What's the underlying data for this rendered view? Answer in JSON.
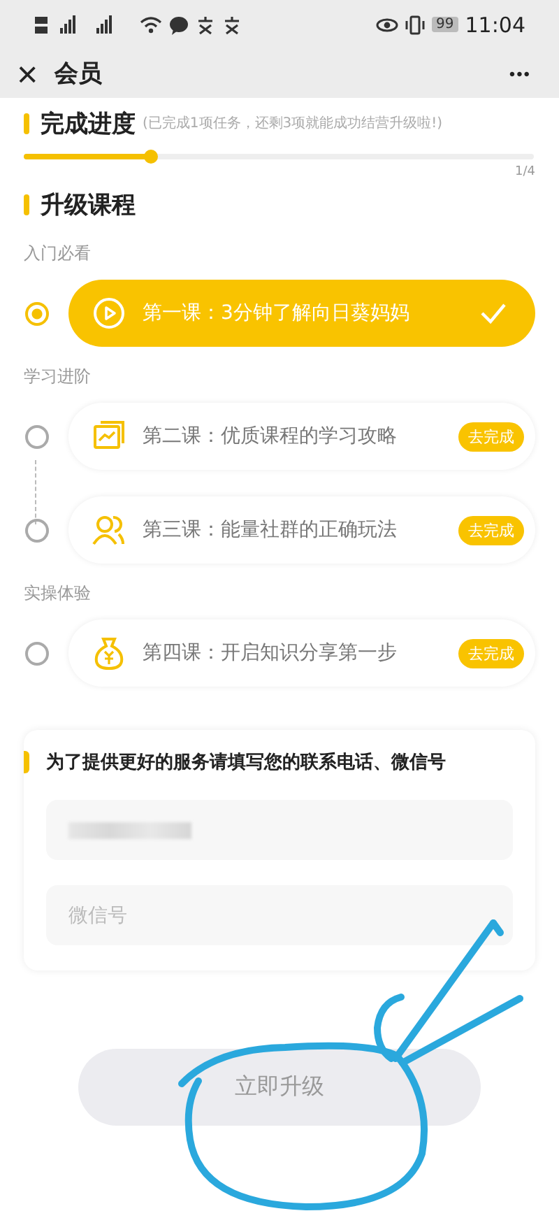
{
  "status_bar": {
    "battery": "99",
    "time": "11:04"
  },
  "nav": {
    "close": "×",
    "title": "会员",
    "more": "•••"
  },
  "progress": {
    "title": "完成进度",
    "note": "(已完成1项任务，还剩3项就能成功结营升级啦!)",
    "level": 0.25,
    "count": "1/4"
  },
  "courses": {
    "title": "升级课程",
    "groups": [
      {
        "label": "入门必看",
        "lessons": [
          {
            "title": "第一课：3分钟了解向日葵妈妈",
            "done": true
          }
        ]
      },
      {
        "label": "学习进阶",
        "lessons": [
          {
            "title": "第二课：优质课程的学习攻略",
            "done": false,
            "action": "去完成"
          },
          {
            "title": "第三课：能量社群的正确玩法",
            "done": false,
            "action": "去完成"
          }
        ]
      },
      {
        "label": "实操体验",
        "lessons": [
          {
            "title": "第四课：开启知识分享第一步",
            "done": false,
            "action": "去完成"
          }
        ]
      }
    ]
  },
  "contact": {
    "title": "为了提供更好的服务请填写您的联系电话、微信号",
    "fields": [
      {
        "kind": "redacted"
      },
      {
        "kind": "empty",
        "placeholder": "微信号"
      }
    ]
  },
  "submit": {
    "label": "立即升级",
    "disabled": true
  }
}
